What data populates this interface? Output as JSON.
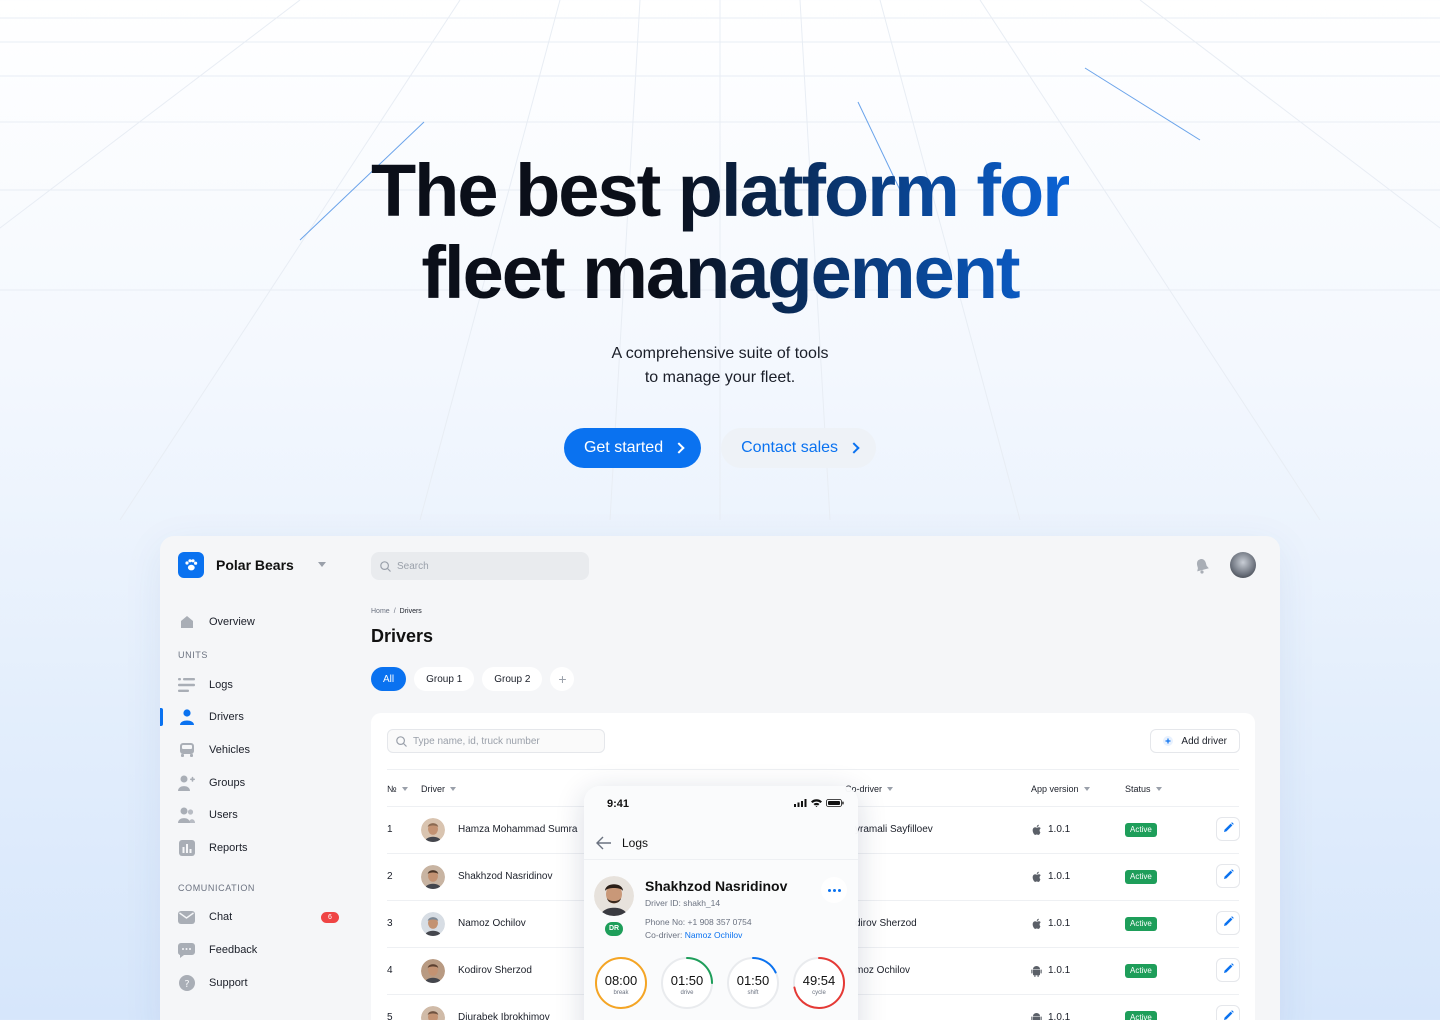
{
  "hero": {
    "title_line1": "The best platform for",
    "title_line2": "fleet management",
    "subtitle_line1": "A comprehensive suite of tools",
    "subtitle_line2": "to manage your fleet.",
    "primary_button": "Get started",
    "secondary_button": "Contact sales"
  },
  "app": {
    "brand": "Polar Bears",
    "search_placeholder": "Search",
    "nav": {
      "overview": "Overview",
      "section_units": "UNITS",
      "logs": "Logs",
      "drivers": "Drivers",
      "vehicles": "Vehicles",
      "groups": "Groups",
      "users": "Users",
      "reports": "Reports",
      "section_communication": "COMUNICATION",
      "chat": "Chat",
      "chat_badge": "6",
      "feedback": "Feedback",
      "support": "Support"
    },
    "breadcrumb": {
      "home": "Home",
      "separator": "/",
      "current": "Drivers"
    },
    "page_title": "Drivers",
    "chips": [
      "All",
      "Group 1",
      "Group 2"
    ],
    "table": {
      "search_placeholder": "Type name, id, truck number",
      "add_button": "Add driver",
      "headers": {
        "num": "№",
        "driver": "Driver",
        "codriver": "Co-driver",
        "app_version": "App version",
        "status": "Status"
      },
      "rows": [
        {
          "num": "1",
          "driver": "Hamza Mohammad Sumra",
          "codriver": "yramali Sayfilloev",
          "os": "apple",
          "version": "1.0.1",
          "status": "Active"
        },
        {
          "num": "2",
          "driver": "Shakhzod Nasridinov",
          "codriver": "",
          "os": "apple",
          "version": "1.0.1",
          "status": "Active"
        },
        {
          "num": "3",
          "driver": "Namoz Ochilov",
          "codriver": "dirov Sherzod",
          "os": "apple",
          "version": "1.0.1",
          "status": "Active"
        },
        {
          "num": "4",
          "driver": "Kodirov Sherzod",
          "codriver": "moz Ochilov",
          "os": "android",
          "version": "1.0.1",
          "status": "Active"
        },
        {
          "num": "5",
          "driver": "Djurabek Ibrokhimov",
          "codriver": "",
          "os": "android",
          "version": "1.0.1",
          "status": "Active"
        }
      ]
    }
  },
  "phone": {
    "time": "9:41",
    "header": "Logs",
    "name": "Shakhzod Nasridinov",
    "driver_id": "Driver ID: shakh_14",
    "phone": "Phone No: +1 908 357 0754",
    "codriver_label": "Co-driver: ",
    "codriver_name": "Namoz Ochilov",
    "role_badge": "DR",
    "gauges": [
      {
        "value": "08:00",
        "label": "break",
        "color": "#f5a524",
        "fraction": 1.0
      },
      {
        "value": "01:50",
        "label": "drive",
        "color": "#1e9e5a",
        "fraction": 0.25
      },
      {
        "value": "01:50",
        "label": "shift",
        "color": "#0a72f0",
        "fraction": 0.18
      },
      {
        "value": "49:54",
        "label": "cycle",
        "color": "#e53935",
        "fraction": 0.72
      }
    ]
  },
  "colors": {
    "accent": "#0a72f0",
    "active_green": "#1e9e5a",
    "badge_red": "#ef4444"
  }
}
